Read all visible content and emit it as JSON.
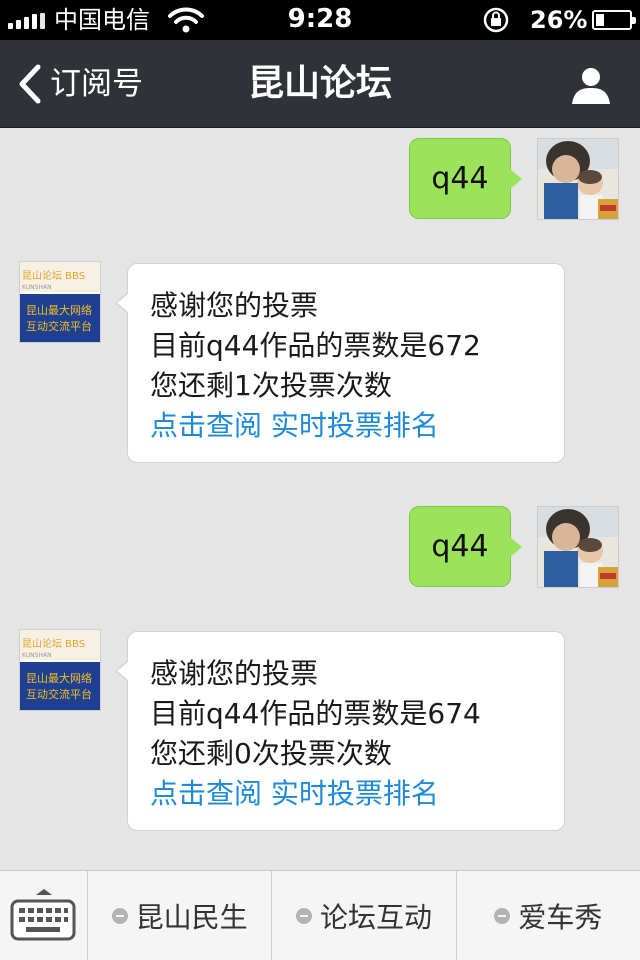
{
  "status_bar": {
    "carrier": "中国电信",
    "time": "9:28",
    "battery_percent": "26%",
    "battery_level": 0.26
  },
  "nav": {
    "back_label": "订阅号",
    "title": "昆山论坛"
  },
  "bbs_logo": {
    "top": "昆山论坛 BBS",
    "sub": "KUNSHAN",
    "line1": "昆山最大网络",
    "line2": "互动交流平台"
  },
  "messages": [
    {
      "from": "me",
      "text": "q44"
    },
    {
      "from": "account",
      "lines": [
        "感谢您的投票",
        "目前q44作品的票数是672",
        "您还剩1次投票次数"
      ],
      "links": [
        "点击查阅 实时投票排名"
      ]
    },
    {
      "from": "me",
      "text": "q44"
    },
    {
      "from": "account",
      "lines": [
        "感谢您的投票",
        "目前q44作品的票数是674",
        "您还剩0次投票次数"
      ],
      "links": [
        "点击查阅 实时投票排名"
      ]
    }
  ],
  "menu": {
    "items": [
      "昆山民生",
      "论坛互动",
      "爱车秀"
    ]
  },
  "icons": {
    "back": "chevron-left-icon",
    "profile": "person-icon",
    "keyboard": "keyboard-icon",
    "menu": "menu-dot-icon"
  }
}
